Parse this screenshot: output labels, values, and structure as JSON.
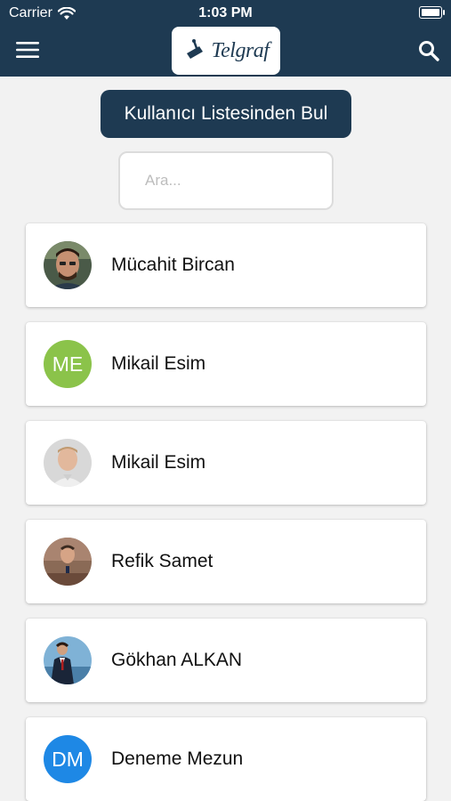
{
  "status_bar": {
    "carrier": "Carrier",
    "time": "1:03 PM"
  },
  "header": {
    "logo_text": "Telgraf",
    "menu_icon": "hamburger-menu-icon",
    "search_icon": "search-icon",
    "background": "#1e3a52"
  },
  "find_button": {
    "label": "Kullanıcı Listesinden Bul"
  },
  "search": {
    "placeholder": "Ara...",
    "value": ""
  },
  "users": [
    {
      "name": "Mücahit Bircan",
      "avatar_type": "photo",
      "initials": ""
    },
    {
      "name": "Mikail Esim",
      "avatar_type": "initials",
      "initials": "ME",
      "color": "#8bc34a"
    },
    {
      "name": "Mikail Esim",
      "avatar_type": "photo",
      "initials": ""
    },
    {
      "name": "Refik Samet",
      "avatar_type": "photo",
      "initials": ""
    },
    {
      "name": "Gökhan ALKAN",
      "avatar_type": "photo",
      "initials": ""
    },
    {
      "name": "Deneme Mezun",
      "avatar_type": "initials",
      "initials": "DM",
      "color": "#1e88e5"
    }
  ]
}
